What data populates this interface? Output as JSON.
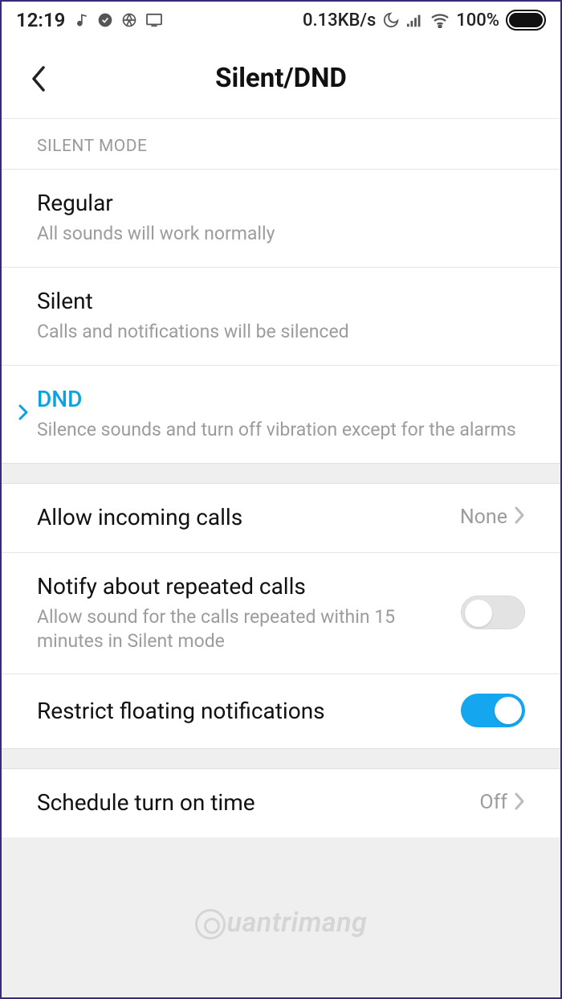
{
  "statusbar": {
    "time": "12:19",
    "net_speed": "0.13KB/s",
    "battery_pct": "100%"
  },
  "header": {
    "title": "Silent/DND"
  },
  "section_silent_mode": {
    "label": "SILENT MODE"
  },
  "modes": {
    "regular": {
      "title": "Regular",
      "sub": "All sounds will work normally"
    },
    "silent": {
      "title": "Silent",
      "sub": "Calls and notifications will be silenced"
    },
    "dnd": {
      "title": "DND",
      "sub": "Silence sounds and turn off vibration except for the alarms"
    }
  },
  "settings": {
    "allow_incoming": {
      "title": "Allow incoming calls",
      "value": "None"
    },
    "repeated_calls": {
      "title": "Notify about repeated calls",
      "sub": "Allow sound for the calls repeated within 15 minutes in Silent mode",
      "on": false
    },
    "restrict_floating": {
      "title": "Restrict floating notifications",
      "on": true
    },
    "schedule": {
      "title": "Schedule turn on time",
      "value": "Off"
    }
  },
  "watermark": "uantrimang"
}
